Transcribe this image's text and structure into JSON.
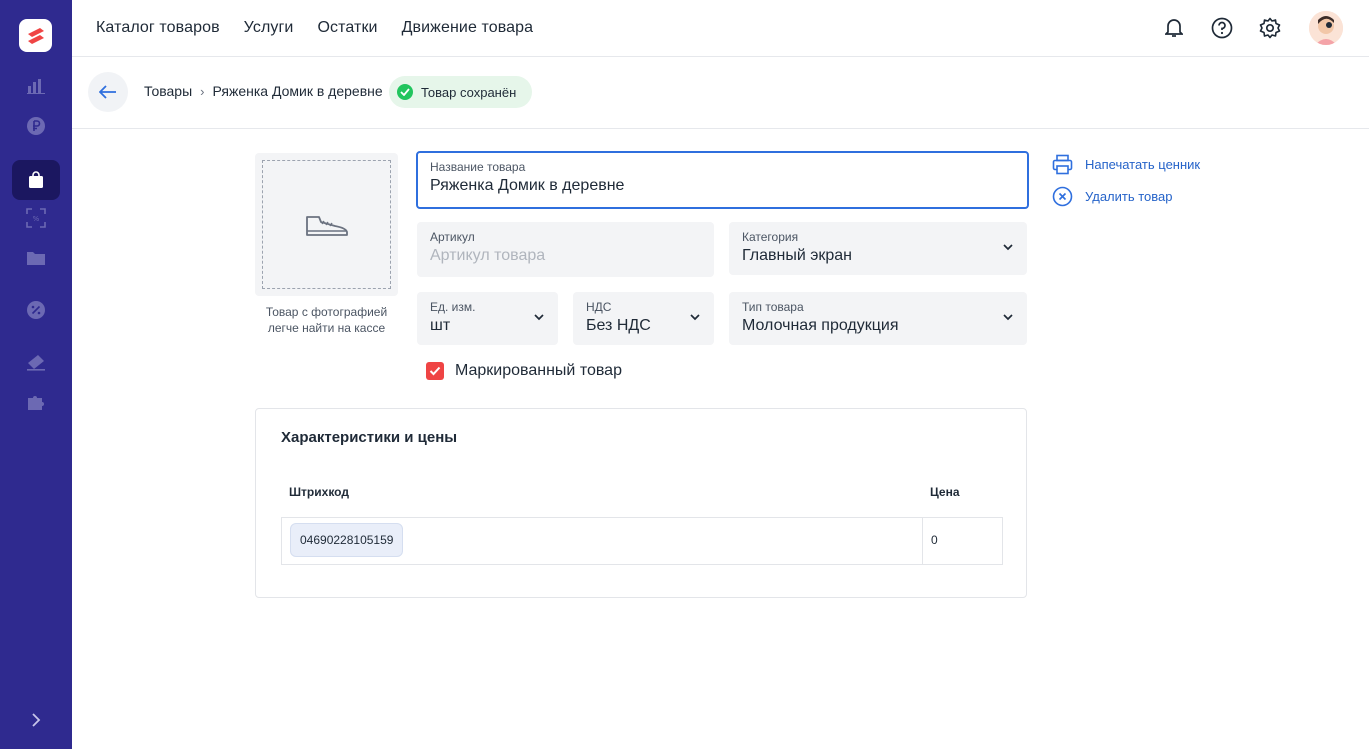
{
  "topnav": {
    "catalog": "Каталог товаров",
    "services": "Услуги",
    "stock": "Остатки",
    "movement": "Движение товара"
  },
  "breadcrumb": {
    "parent": "Товары",
    "current": "Ряженка Домик в деревне",
    "status": "Товар сохранён"
  },
  "photo": {
    "hint": "Товар с фотографией легче найти на кассе"
  },
  "form": {
    "name_label": "Название товара",
    "name_value": "Ряженка Домик в деревне",
    "sku_label": "Артикул",
    "sku_placeholder": "Артикул товара",
    "category_label": "Категория",
    "category_value": "Главный экран",
    "unit_label": "Ед. изм.",
    "unit_value": "шт",
    "vat_label": "НДС",
    "vat_value": "Без НДС",
    "type_label": "Тип товара",
    "type_value": "Молочная продукция",
    "marked_label": "Маркированный товар",
    "marked_checked": true
  },
  "actions": {
    "print": "Напечатать ценник",
    "delete": "Удалить товар"
  },
  "characteristics": {
    "title": "Характеристики и цены",
    "col_barcode": "Штрихкод",
    "col_price": "Цена",
    "rows": [
      {
        "barcode": "04690228105159",
        "price": "0"
      }
    ]
  },
  "colors": {
    "sidebar": "#2f2a8f",
    "accent": "#2f6fde",
    "success": "#22c55e",
    "checkbox": "#ef4444"
  }
}
